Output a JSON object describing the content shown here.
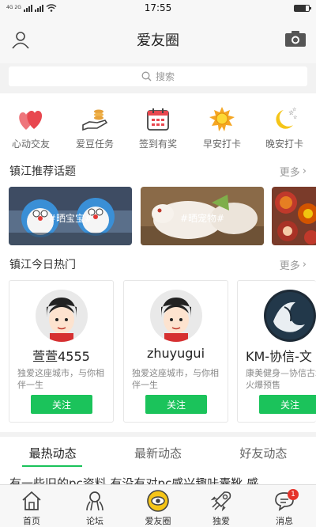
{
  "status_bar": {
    "network": "4G 2G",
    "time": "17:55",
    "battery_level": 0.8
  },
  "header": {
    "title": "爱友圈"
  },
  "search": {
    "placeholder": "搜索"
  },
  "quick_actions": [
    {
      "label": "心动交友",
      "icon": "hearts-icon"
    },
    {
      "label": "爱豆任务",
      "icon": "coins-hand-icon"
    },
    {
      "label": "签到有奖",
      "icon": "calendar-icon"
    },
    {
      "label": "早安打卡",
      "icon": "sun-icon"
    },
    {
      "label": "晚安打卡",
      "icon": "moon-stars-icon"
    }
  ],
  "recommended_topics": {
    "title": "镇江推荐话题",
    "more_label": "更多",
    "items": [
      {
        "label": "#晒宝宝#"
      },
      {
        "label": "#晒宠物#"
      },
      {
        "label": ""
      }
    ]
  },
  "hot_today": {
    "title": "镇江今日热门",
    "more_label": "更多",
    "users": [
      {
        "name": "萱萱4555",
        "desc": "独爱这座城市，与你相伴一生",
        "button": "关注"
      },
      {
        "name": "zhuyugui",
        "desc": "独爱这座城市，与你相伴一生",
        "button": "关注"
      },
      {
        "name": "KM-协信-文",
        "desc": "康美健身—协信古城店火爆预售",
        "button": "关注"
      }
    ]
  },
  "feed_tabs": [
    {
      "label": "最热动态"
    },
    {
      "label": "最新动态"
    },
    {
      "label": "好友动态"
    }
  ],
  "feed_preview": "有一些旧的pc资料 有没有对pc感兴趣咔囊靴 感",
  "bottom_nav": [
    {
      "label": "首页",
      "icon": "home-icon"
    },
    {
      "label": "论坛",
      "icon": "forum-icon"
    },
    {
      "label": "爱友圈",
      "icon": "circle-eye-icon"
    },
    {
      "label": "独爱",
      "icon": "rocket-icon"
    },
    {
      "label": "消息",
      "icon": "message-icon",
      "badge": "1"
    }
  ],
  "colors": {
    "accent": "#1bc35b",
    "badge": "#e5332a",
    "heart": "#e8474f",
    "sun": "#f5a623"
  }
}
